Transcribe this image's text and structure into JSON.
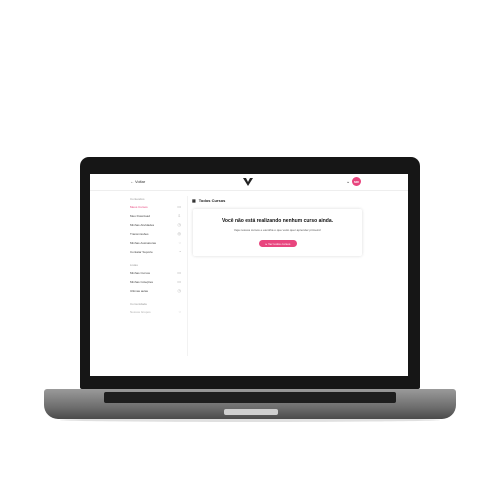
{
  "topbar": {
    "back_label": "Voltar",
    "back_icon": "arrow-left-icon",
    "avatar_initials": "MR",
    "avatar_color": "#e8457e"
  },
  "sidebar": {
    "sections": [
      {
        "title": "Conteúdos",
        "items": [
          {
            "label": "Meus Cursos",
            "icon": "book-icon",
            "active": true
          },
          {
            "label": "Meu Download",
            "icon": "download-icon"
          },
          {
            "label": "Minhas Atividades",
            "icon": "activity-icon"
          },
          {
            "label": "Transmissões",
            "icon": "broadcast-icon"
          },
          {
            "label": "Minhas Assinaturas",
            "icon": "subscription-icon"
          },
          {
            "label": "Contatar Suporte",
            "icon": "support-icon"
          }
        ]
      },
      {
        "title": "Listas",
        "items": [
          {
            "label": "Minhas Cursos",
            "icon": "list-icon"
          },
          {
            "label": "Minhas Coleções",
            "icon": "collection-icon"
          },
          {
            "label": "Ultimas aulas",
            "icon": "clock-icon"
          }
        ]
      },
      {
        "title": "Comunidade",
        "items": [
          {
            "label": "Nossos Grupos",
            "icon": "group-icon",
            "muted": true
          }
        ]
      }
    ]
  },
  "main": {
    "title": "Todos Cursos",
    "title_icon": "grid-icon",
    "empty_title": "Você não está realizando nenhum curso ainda.",
    "empty_subtitle": "Veja nossos cursos e escolha o que você quer aprender primeiro!",
    "cta_label": "Ver todos cursos",
    "cta_icon": "play-icon",
    "accent_color": "#e8457e"
  }
}
